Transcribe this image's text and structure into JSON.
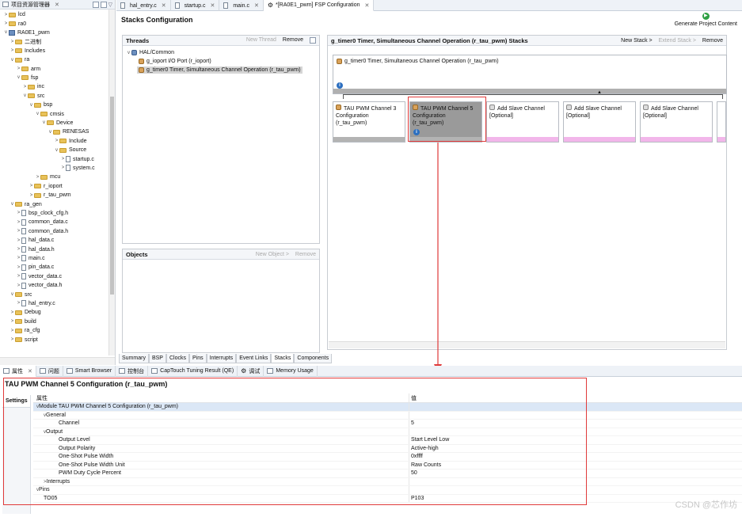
{
  "explorer": {
    "title": "项目资源管理器",
    "items": [
      {
        "d": 0,
        "tw": ">",
        "ic": "folder",
        "t": "lcd"
      },
      {
        "d": 0,
        "tw": ">",
        "ic": "folder",
        "t": "ra0"
      },
      {
        "d": 0,
        "tw": "v",
        "ic": "proj",
        "t": "RA0E1_pwm"
      },
      {
        "d": 1,
        "tw": ">",
        "ic": "folder",
        "t": "二进制"
      },
      {
        "d": 1,
        "tw": ">",
        "ic": "folder",
        "t": "Includes"
      },
      {
        "d": 1,
        "tw": "v",
        "ic": "folder",
        "t": "ra"
      },
      {
        "d": 2,
        "tw": ">",
        "ic": "folder",
        "t": "arm"
      },
      {
        "d": 2,
        "tw": "v",
        "ic": "folder",
        "t": "fsp"
      },
      {
        "d": 3,
        "tw": ">",
        "ic": "folder",
        "t": "inc"
      },
      {
        "d": 3,
        "tw": "v",
        "ic": "folder",
        "t": "src"
      },
      {
        "d": 4,
        "tw": "v",
        "ic": "folder",
        "t": "bsp"
      },
      {
        "d": 5,
        "tw": "v",
        "ic": "folder",
        "t": "cmsis"
      },
      {
        "d": 6,
        "tw": "v",
        "ic": "folder",
        "t": "Device"
      },
      {
        "d": 7,
        "tw": "v",
        "ic": "folder",
        "t": "RENESAS"
      },
      {
        "d": 8,
        "tw": ">",
        "ic": "folder",
        "t": "Include"
      },
      {
        "d": 8,
        "tw": "v",
        "ic": "folder",
        "t": "Source"
      },
      {
        "d": 9,
        "tw": ">",
        "ic": "file",
        "t": "startup.c"
      },
      {
        "d": 9,
        "tw": ">",
        "ic": "file",
        "t": "system.c"
      },
      {
        "d": 5,
        "tw": ">",
        "ic": "folder",
        "t": "mcu"
      },
      {
        "d": 4,
        "tw": ">",
        "ic": "folder",
        "t": "r_ioport"
      },
      {
        "d": 4,
        "tw": ">",
        "ic": "folder",
        "t": "r_tau_pwm"
      },
      {
        "d": 1,
        "tw": "v",
        "ic": "folder",
        "t": "ra_gen"
      },
      {
        "d": 2,
        "tw": ">",
        "ic": "file",
        "t": "bsp_clock_cfg.h"
      },
      {
        "d": 2,
        "tw": ">",
        "ic": "file",
        "t": "common_data.c"
      },
      {
        "d": 2,
        "tw": ">",
        "ic": "file",
        "t": "common_data.h"
      },
      {
        "d": 2,
        "tw": ">",
        "ic": "file",
        "t": "hal_data.c"
      },
      {
        "d": 2,
        "tw": ">",
        "ic": "file",
        "t": "hal_data.h"
      },
      {
        "d": 2,
        "tw": ">",
        "ic": "file",
        "t": "main.c"
      },
      {
        "d": 2,
        "tw": ">",
        "ic": "file",
        "t": "pin_data.c"
      },
      {
        "d": 2,
        "tw": ">",
        "ic": "file",
        "t": "vector_data.c"
      },
      {
        "d": 2,
        "tw": ">",
        "ic": "file",
        "t": "vector_data.h"
      },
      {
        "d": 1,
        "tw": "v",
        "ic": "folder",
        "t": "src"
      },
      {
        "d": 2,
        "tw": ">",
        "ic": "file",
        "t": "hal_entry.c"
      },
      {
        "d": 1,
        "tw": ">",
        "ic": "folder",
        "t": "Debug"
      },
      {
        "d": 1,
        "tw": ">",
        "ic": "folder",
        "t": "build"
      },
      {
        "d": 1,
        "tw": ">",
        "ic": "folder",
        "t": "ra_cfg"
      },
      {
        "d": 1,
        "tw": ">",
        "ic": "folder",
        "t": "script"
      }
    ]
  },
  "tabs": [
    "hal_entry.c",
    "startup.c",
    "main.c",
    "*[RA0E1_pwm] FSP Configuration"
  ],
  "editor": {
    "title": "Stacks Configuration",
    "generate": "Generate Project Content"
  },
  "threads": {
    "title": "Threads",
    "new": "New Thread",
    "remove": "Remove",
    "root": "HAL/Common",
    "items": [
      "g_ioport I/O Port (r_ioport)",
      "g_timer0 Timer, Simultaneous Channel Operation (r_tau_pwm)"
    ]
  },
  "objects": {
    "title": "Objects",
    "new": "New Object >",
    "remove": "Remove"
  },
  "stacks": {
    "title": "g_timer0 Timer, Simultaneous Channel Operation (r_tau_pwm) Stacks",
    "new": "New Stack >",
    "extend": "Extend Stack >",
    "remove": "Remove",
    "top": "g_timer0 Timer, Simultaneous Channel Operation (r_tau_pwm)",
    "cards": [
      {
        "l1": "TAU PWM Channel 3",
        "l2": "Configuration",
        "l3": "(r_tau_pwm)"
      },
      {
        "l1": "TAU PWM Channel 5",
        "l2": "Configuration",
        "l3": "(r_tau_pwm)"
      },
      {
        "l1": "Add Slave Channel",
        "l2": "[Optional]",
        "l3": ""
      },
      {
        "l1": "Add Slave Channel",
        "l2": "[Optional]",
        "l3": ""
      },
      {
        "l1": "Add Slave Channel",
        "l2": "[Optional]",
        "l3": ""
      }
    ]
  },
  "bottom_tabs": [
    "Summary",
    "BSP",
    "Clocks",
    "Pins",
    "Interrupts",
    "Event Links",
    "Stacks",
    "Components"
  ],
  "view_tabs": [
    "属性",
    "问题",
    "Smart Browser",
    "控制台",
    "CapTouch Tuning Result (QE)",
    "调试",
    "Memory Usage"
  ],
  "props": {
    "title": "TAU PWM Channel 5 Configuration (r_tau_pwm)",
    "settings": "Settings",
    "col1": "属性",
    "col2": "值",
    "rows": [
      {
        "lvl": 0,
        "tw": "v",
        "k": "Module TAU PWM Channel 5 Configuration (r_tau_pwm)",
        "v": "",
        "hl": true
      },
      {
        "lvl": 1,
        "tw": "v",
        "k": "General",
        "v": ""
      },
      {
        "lvl": 2,
        "tw": "",
        "k": "Channel",
        "v": "5"
      },
      {
        "lvl": 1,
        "tw": "v",
        "k": "Output",
        "v": ""
      },
      {
        "lvl": 2,
        "tw": "",
        "k": "Output Level",
        "v": "Start Level Low"
      },
      {
        "lvl": 2,
        "tw": "",
        "k": "Output Polarity",
        "v": "Active-high"
      },
      {
        "lvl": 2,
        "tw": "",
        "k": "One-Shot Pulse Width",
        "v": "0xffff"
      },
      {
        "lvl": 2,
        "tw": "",
        "k": "One-Shot Pulse Width Unit",
        "v": "Raw Counts"
      },
      {
        "lvl": 2,
        "tw": "",
        "k": "PWM Duty Cycle Percent",
        "v": "50"
      },
      {
        "lvl": 1,
        "tw": ">",
        "k": "Interrupts",
        "v": ""
      },
      {
        "lvl": 0,
        "tw": "v",
        "k": "Pins",
        "v": ""
      },
      {
        "lvl": 1,
        "tw": "",
        "k": "TO05",
        "v": "P103"
      }
    ]
  },
  "watermark": "CSDN @芯作坊",
  "colors": {
    "highlight_red": "#e03a3a",
    "selected_card": "#9a9a9a",
    "slave_bar": "#f2b6ea"
  }
}
